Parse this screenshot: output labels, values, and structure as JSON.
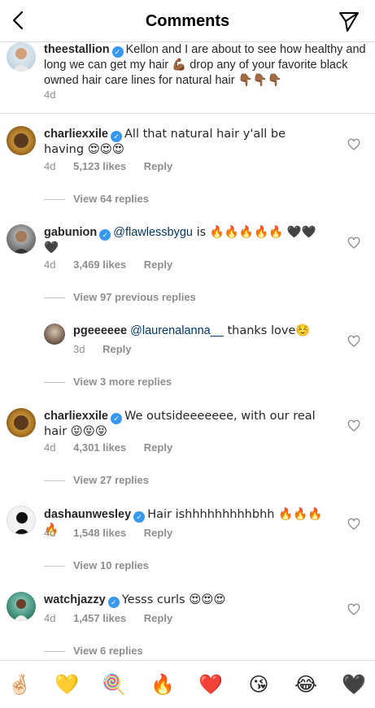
{
  "header": {
    "title": "Comments"
  },
  "caption": {
    "username": "theestallion",
    "text": "Kellon and I are about to see how healthy and long we can get my hair 💪🏾 drop any of your favorite black owned hair care lines for natural hair 👇🏾👇🏾👇🏾",
    "time": "4d"
  },
  "comments": [
    {
      "username": "charliexxile",
      "text": "All that natural hair y'all be having 😍😍😍",
      "time": "4d",
      "likes": "5,123 likes",
      "reply": "Reply",
      "view_replies": "View 64 replies"
    },
    {
      "username": "gabunion",
      "mention": "@flawlessbygu",
      "text": " is 🔥🔥🔥🔥🔥 🖤🖤🖤",
      "time": "4d",
      "likes": "3,469 likes",
      "reply": "Reply",
      "view_replies": "View 97 previous replies"
    },
    {
      "username": "pgeeeeee",
      "mention": "@laurenalanna__",
      "text": " thanks love☺️",
      "time": "3d",
      "reply": "Reply",
      "view_replies": "View 3 more replies"
    },
    {
      "username": "charliexxile",
      "text": "We outsideeeeeee, with our real hair 😝😝😝",
      "time": "4d",
      "likes": "4,301 likes",
      "reply": "Reply",
      "view_replies": "View 27 replies"
    },
    {
      "username": "dashaunwesley",
      "text": "Hair ishhhhhhhhhbhh 🔥🔥🔥🔥",
      "time": "4d",
      "likes": "1,548 likes",
      "reply": "Reply",
      "view_replies": "View 10 replies"
    },
    {
      "username": "watchjazzy",
      "text": "Yesss curls 😍😍😍",
      "time": "4d",
      "likes": "1,457 likes",
      "reply": "Reply",
      "view_replies": "View 6 replies"
    }
  ],
  "emoji_bar": [
    "🤞🏻",
    "💛",
    "🍭",
    "🔥",
    "❤️",
    "😘",
    "😂",
    "🖤"
  ],
  "colors": {
    "accent": "#3897f0",
    "muted": "#8e8e8e",
    "mention": "#00376b"
  }
}
